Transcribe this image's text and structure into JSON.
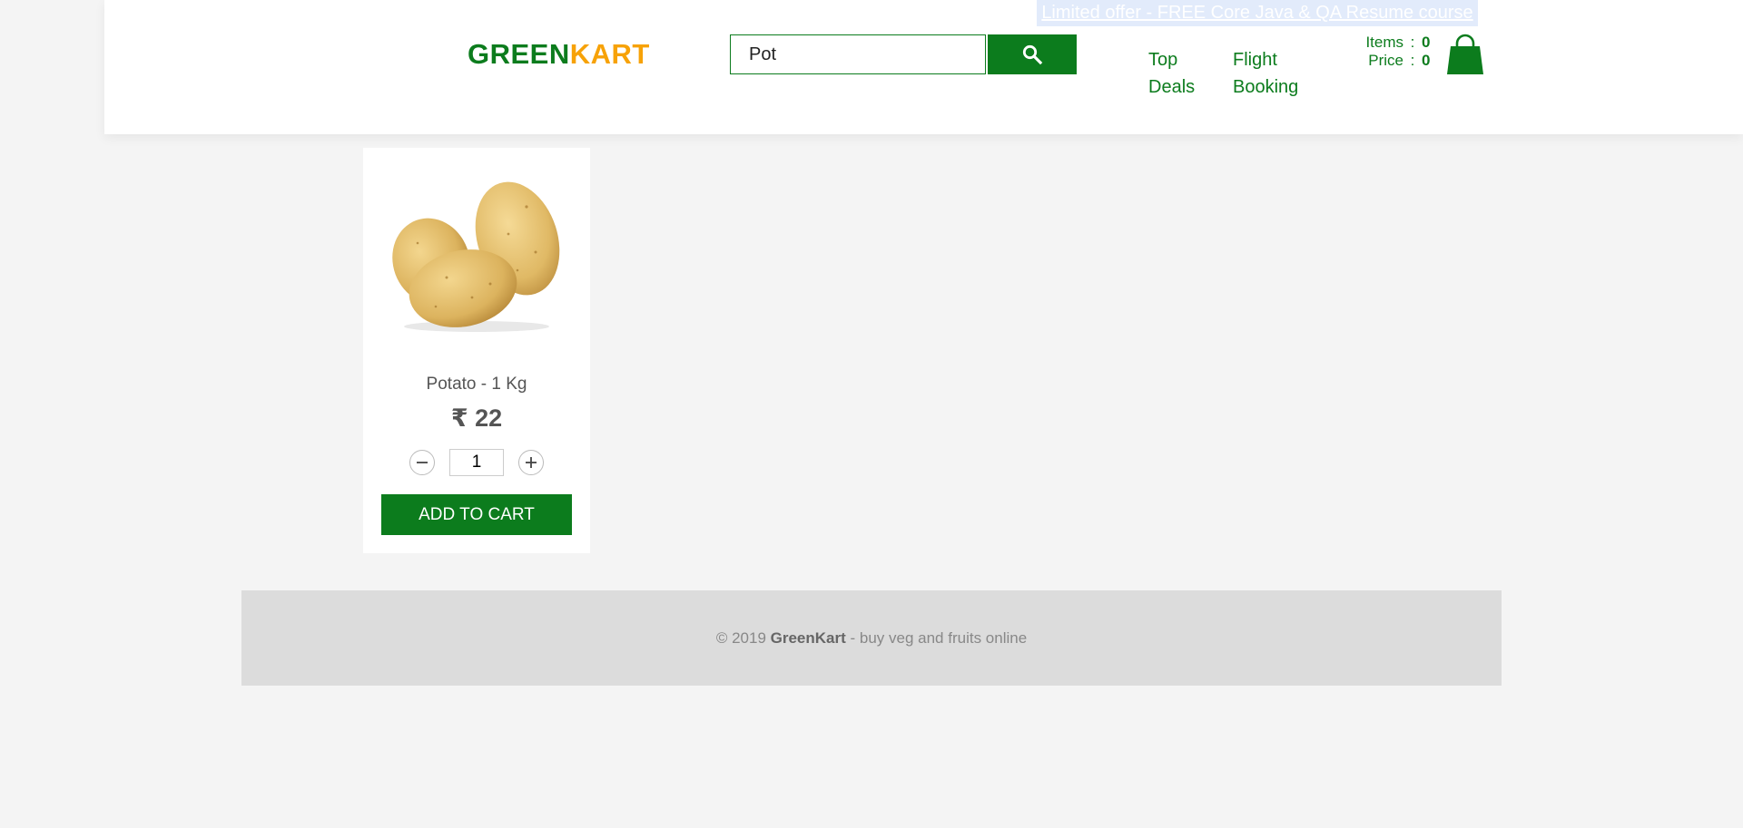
{
  "offer": {
    "text": "Limited offer - FREE Core Java & QA Resume course"
  },
  "brand": {
    "part1": "GREEN",
    "part2": "KART",
    "colors": {
      "green": "#0c7c1d",
      "orange": "#f7a208"
    }
  },
  "search": {
    "value": "Pot",
    "button_icon": "search-icon"
  },
  "nav": {
    "top_deals": {
      "line1": "Top",
      "line2": "Deals"
    },
    "flight_booking": {
      "line1": "Flight",
      "line2": "Booking"
    }
  },
  "cart": {
    "items_label": "Items",
    "items_value": "0",
    "price_label": "Price",
    "price_value": "0",
    "separator": ":",
    "icon": "shopping-bag-icon"
  },
  "products": [
    {
      "name": "Potato - 1 Kg",
      "price": "₹ 22",
      "quantity": "1",
      "add_label": "ADD TO CART",
      "image_icon": "potato-image"
    }
  ],
  "footer": {
    "prefix": "© 2019 ",
    "brand": "GreenKart",
    "suffix": " - buy veg and fruits online"
  }
}
